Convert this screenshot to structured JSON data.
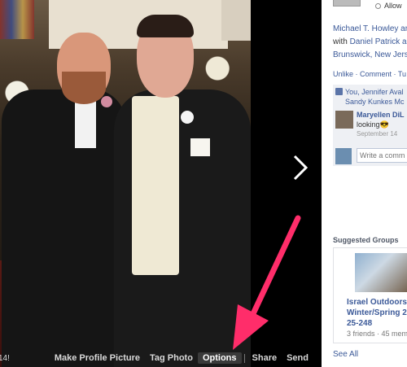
{
  "photo_actions": {
    "counter": "14!",
    "make_profile_picture": "Make Profile Picture",
    "tag_photo": "Tag Photo",
    "options": "Options",
    "share": "Share",
    "send": "Send"
  },
  "sidebar": {
    "privacy_label": "Allow",
    "post_line1": "Michael T. Howley ar",
    "post_line2_prefix": "with",
    "post_line2_name": "Daniel Patrick a",
    "post_line3": "Brunswick, New Jers",
    "actions": "Unlike · Comment · Tu",
    "likes_line1": "You, Jennifer Aval",
    "likes_line2": "Sandy Kunkes Mc",
    "comment": {
      "author": "Maryellen DiL",
      "text": "looking😎",
      "date": "September 14"
    },
    "write_placeholder": "Write a comm",
    "suggested_groups_title": "Suggested Groups",
    "group": {
      "name_line1": "Israel Outdoors /",
      "name_line2": "Winter/Spring 20",
      "name_line3": "25-248",
      "meta": "3 friends · 45 mem"
    },
    "see_all": "See All"
  },
  "colors": {
    "annotation_arrow": "#ff2d6a",
    "facebook_blue": "#3b5998"
  }
}
